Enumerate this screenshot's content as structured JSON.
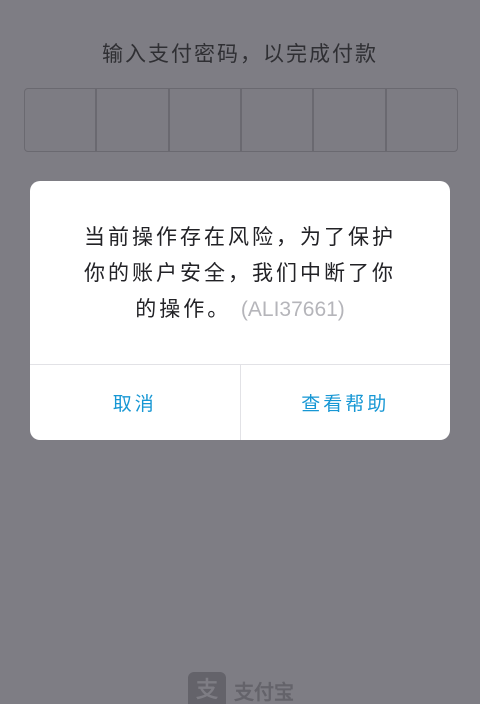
{
  "payment": {
    "prompt": "输入支付密码，以完成付款",
    "pin_slots": 6
  },
  "dialog": {
    "message": "当前操作存在风险，为了保护你的账户安全，我们中断了你的操作。",
    "error_code": "(ALI37661)",
    "cancel_label": "取消",
    "help_label": "查看帮助"
  },
  "brand": {
    "logo_glyph": "支",
    "name": "支付宝"
  },
  "colors": {
    "overlay_background": "#7e7d84",
    "button_text": "#1797d4",
    "error_code": "#b5b5ba"
  }
}
